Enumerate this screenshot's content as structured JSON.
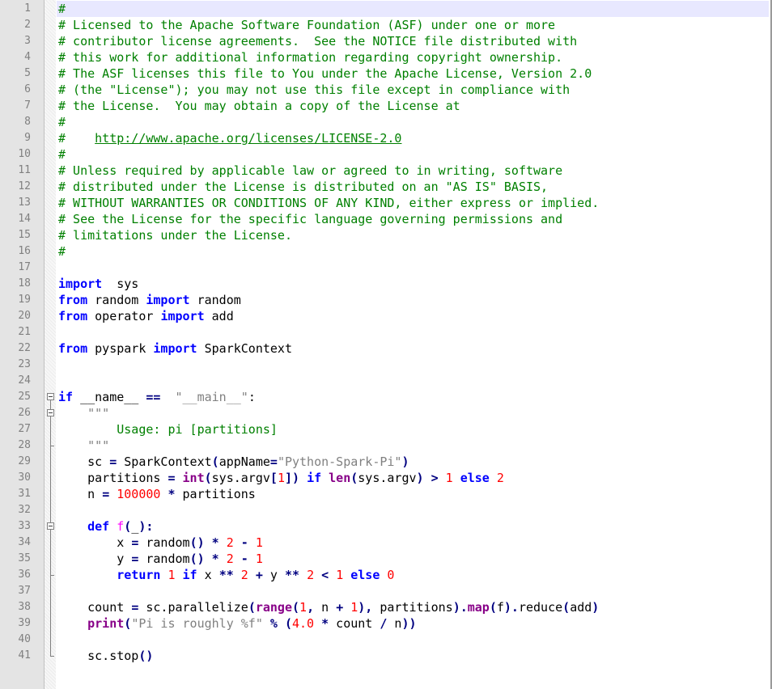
{
  "editor": {
    "lines": [
      {
        "n": "1",
        "tokens": [
          [
            "cm",
            "#"
          ]
        ]
      },
      {
        "n": "2",
        "tokens": [
          [
            "cm",
            "# Licensed to the Apache Software Foundation (ASF) under one or more"
          ]
        ]
      },
      {
        "n": "3",
        "tokens": [
          [
            "cm",
            "# contributor license agreements.  See the NOTICE file distributed with"
          ]
        ]
      },
      {
        "n": "4",
        "tokens": [
          [
            "cm",
            "# this work for additional information regarding copyright ownership."
          ]
        ]
      },
      {
        "n": "5",
        "tokens": [
          [
            "cm",
            "# The ASF licenses this file to You under the Apache License, Version 2.0"
          ]
        ]
      },
      {
        "n": "6",
        "tokens": [
          [
            "cm",
            "# (the \"License\"); you may not use this file except in compliance with"
          ]
        ]
      },
      {
        "n": "7",
        "tokens": [
          [
            "cm",
            "# the License.  You may obtain a copy of the License at"
          ]
        ]
      },
      {
        "n": "8",
        "tokens": [
          [
            "cm",
            "#"
          ]
        ]
      },
      {
        "n": "9",
        "tokens": [
          [
            "cm",
            "#    "
          ],
          [
            "url",
            "http://www.apache.org/licenses/LICENSE-2.0"
          ]
        ]
      },
      {
        "n": "10",
        "tokens": [
          [
            "cm",
            "#"
          ]
        ]
      },
      {
        "n": "11",
        "tokens": [
          [
            "cm",
            "# Unless required by applicable law or agreed to in writing, software"
          ]
        ]
      },
      {
        "n": "12",
        "tokens": [
          [
            "cm",
            "# distributed under the License is distributed on an \"AS IS\" BASIS,"
          ]
        ]
      },
      {
        "n": "13",
        "tokens": [
          [
            "cm",
            "# WITHOUT WARRANTIES OR CONDITIONS OF ANY KIND, either express or implied."
          ]
        ]
      },
      {
        "n": "14",
        "tokens": [
          [
            "cm",
            "# See the License for the specific language governing permissions and"
          ]
        ]
      },
      {
        "n": "15",
        "tokens": [
          [
            "cm",
            "# limitations under the License."
          ]
        ]
      },
      {
        "n": "16",
        "tokens": [
          [
            "cm",
            "#"
          ]
        ]
      },
      {
        "n": "17",
        "tokens": []
      },
      {
        "n": "18",
        "tokens": [
          [
            "kw",
            "import"
          ],
          [
            "",
            "  sys"
          ]
        ]
      },
      {
        "n": "19",
        "tokens": [
          [
            "kw",
            "from"
          ],
          [
            "",
            " random "
          ],
          [
            "kw",
            "import"
          ],
          [
            "",
            " random"
          ]
        ]
      },
      {
        "n": "20",
        "tokens": [
          [
            "kw",
            "from"
          ],
          [
            "",
            " operator "
          ],
          [
            "kw",
            "import"
          ],
          [
            "",
            " add"
          ]
        ]
      },
      {
        "n": "21",
        "tokens": []
      },
      {
        "n": "22",
        "tokens": [
          [
            "kw",
            "from"
          ],
          [
            "",
            " pyspark "
          ],
          [
            "kw",
            "import"
          ],
          [
            "",
            " SparkContext"
          ]
        ]
      },
      {
        "n": "23",
        "tokens": []
      },
      {
        "n": "24",
        "tokens": []
      },
      {
        "n": "25",
        "tokens": [
          [
            "kw",
            "if"
          ],
          [
            "",
            " __name__ "
          ],
          [
            "op",
            "=="
          ],
          [
            " ",
            ""
          ],
          [
            "st",
            " \"__main__\""
          ],
          [
            "",
            ":"
          ]
        ]
      },
      {
        "n": "26",
        "tokens": [
          [
            "",
            "    "
          ],
          [
            "st",
            "\"\"\""
          ]
        ]
      },
      {
        "n": "27",
        "tokens": [
          [
            "",
            "        "
          ],
          [
            "cm",
            "Usage: pi [partitions]"
          ]
        ]
      },
      {
        "n": "28",
        "tokens": [
          [
            "",
            "    "
          ],
          [
            "st",
            "\"\"\""
          ]
        ]
      },
      {
        "n": "29",
        "tokens": [
          [
            "",
            "    sc "
          ],
          [
            "op",
            "="
          ],
          [
            "",
            " SparkContext"
          ],
          [
            "op",
            "("
          ],
          [
            "",
            "appName"
          ],
          [
            "op",
            "="
          ],
          [
            "st",
            "\"Python-Spark-Pi\""
          ],
          [
            "op",
            ")"
          ]
        ]
      },
      {
        "n": "30",
        "tokens": [
          [
            "",
            "    partitions "
          ],
          [
            "op",
            "="
          ],
          [
            " ",
            ""
          ],
          [
            "bi",
            "int"
          ],
          [
            "op",
            "("
          ],
          [
            "",
            "sys.argv"
          ],
          [
            "op",
            "["
          ],
          [
            "nm",
            "1"
          ],
          [
            "op",
            "])"
          ],
          [
            " ",
            ""
          ],
          [
            "kw",
            "if"
          ],
          [
            " ",
            ""
          ],
          [
            "bi",
            "len"
          ],
          [
            "op",
            "("
          ],
          [
            "",
            "sys.argv"
          ],
          [
            "op",
            ")"
          ],
          [
            " ",
            ""
          ],
          [
            "op",
            ">"
          ],
          [
            " ",
            ""
          ],
          [
            "nm",
            "1"
          ],
          [
            " ",
            ""
          ],
          [
            "kw",
            "else"
          ],
          [
            " ",
            ""
          ],
          [
            "nm",
            "2"
          ]
        ]
      },
      {
        "n": "31",
        "tokens": [
          [
            "",
            "    n "
          ],
          [
            "op",
            "="
          ],
          [
            " ",
            ""
          ],
          [
            "nm",
            "100000"
          ],
          [
            " ",
            ""
          ],
          [
            "op",
            "*"
          ],
          [
            "",
            " partitions"
          ]
        ]
      },
      {
        "n": "32",
        "tokens": []
      },
      {
        "n": "33",
        "tokens": [
          [
            "",
            "    "
          ],
          [
            "kw",
            "def"
          ],
          [
            " ",
            ""
          ],
          [
            "fn",
            "f"
          ],
          [
            "op",
            "("
          ],
          [
            "",
            "_"
          ],
          [
            "op",
            "):"
          ]
        ]
      },
      {
        "n": "34",
        "tokens": [
          [
            "",
            "        x "
          ],
          [
            "op",
            "="
          ],
          [
            "",
            " random"
          ],
          [
            "op",
            "()"
          ],
          [
            " ",
            ""
          ],
          [
            "op",
            "*"
          ],
          [
            " ",
            ""
          ],
          [
            "nm",
            "2"
          ],
          [
            " ",
            ""
          ],
          [
            "op",
            "-"
          ],
          [
            " ",
            ""
          ],
          [
            "nm",
            "1"
          ]
        ]
      },
      {
        "n": "35",
        "tokens": [
          [
            "",
            "        y "
          ],
          [
            "op",
            "="
          ],
          [
            "",
            " random"
          ],
          [
            "op",
            "()"
          ],
          [
            " ",
            ""
          ],
          [
            "op",
            "*"
          ],
          [
            " ",
            ""
          ],
          [
            "nm",
            "2"
          ],
          [
            " ",
            ""
          ],
          [
            "op",
            "-"
          ],
          [
            " ",
            ""
          ],
          [
            "nm",
            "1"
          ]
        ]
      },
      {
        "n": "36",
        "tokens": [
          [
            "",
            "        "
          ],
          [
            "kw",
            "return"
          ],
          [
            " ",
            ""
          ],
          [
            "nm",
            "1"
          ],
          [
            " ",
            ""
          ],
          [
            "kw",
            "if"
          ],
          [
            "",
            " x "
          ],
          [
            "op",
            "**"
          ],
          [
            " ",
            ""
          ],
          [
            "nm",
            "2"
          ],
          [
            " ",
            ""
          ],
          [
            "op",
            "+"
          ],
          [
            "",
            " y "
          ],
          [
            "op",
            "**"
          ],
          [
            " ",
            ""
          ],
          [
            "nm",
            "2"
          ],
          [
            " ",
            ""
          ],
          [
            "op",
            "<"
          ],
          [
            " ",
            ""
          ],
          [
            "nm",
            "1"
          ],
          [
            " ",
            ""
          ],
          [
            "kw",
            "else"
          ],
          [
            " ",
            ""
          ],
          [
            "nm",
            "0"
          ]
        ]
      },
      {
        "n": "37",
        "tokens": []
      },
      {
        "n": "38",
        "tokens": [
          [
            "",
            "    count "
          ],
          [
            "op",
            "="
          ],
          [
            "",
            " sc.parallelize"
          ],
          [
            "op",
            "("
          ],
          [
            "bi",
            "range"
          ],
          [
            "op",
            "("
          ],
          [
            "nm",
            "1"
          ],
          [
            "op",
            ","
          ],
          [
            "",
            " n "
          ],
          [
            "op",
            "+"
          ],
          [
            " ",
            ""
          ],
          [
            "nm",
            "1"
          ],
          [
            "op",
            "),"
          ],
          [
            "",
            " partitions"
          ],
          [
            "op",
            ")."
          ],
          [
            "bi",
            "map"
          ],
          [
            "op",
            "("
          ],
          [
            "",
            "f"
          ],
          [
            "op",
            ")."
          ],
          [
            "",
            "reduce"
          ],
          [
            "op",
            "("
          ],
          [
            "",
            "add"
          ],
          [
            "op",
            ")"
          ]
        ]
      },
      {
        "n": "39",
        "tokens": [
          [
            "",
            "    "
          ],
          [
            "bi",
            "print"
          ],
          [
            "op",
            "("
          ],
          [
            "st",
            "\"Pi is roughly %f\""
          ],
          [
            " ",
            ""
          ],
          [
            "op",
            "%"
          ],
          [
            " ",
            ""
          ],
          [
            "op",
            "("
          ],
          [
            "nm",
            "4.0"
          ],
          [
            " ",
            ""
          ],
          [
            "op",
            "*"
          ],
          [
            "",
            " count "
          ],
          [
            "op",
            "/"
          ],
          [
            "",
            " n"
          ],
          [
            "op",
            "))"
          ]
        ]
      },
      {
        "n": "40",
        "tokens": []
      },
      {
        "n": "41",
        "tokens": [
          [
            "",
            "    sc.stop"
          ],
          [
            "op",
            "()"
          ]
        ]
      }
    ]
  }
}
